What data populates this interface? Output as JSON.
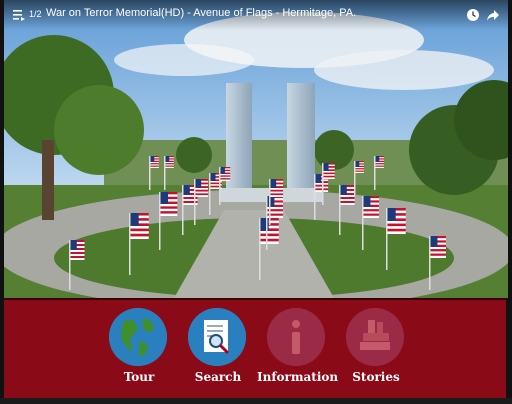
{
  "video": {
    "playlist_position": "1/2",
    "title": "War on Terror Memorial(HD) - Avenue of Flags - Hermitage, PA."
  },
  "menu": {
    "items": [
      {
        "label": "Tour",
        "icon": "globe-icon",
        "color": "#2a7fbf",
        "active": true
      },
      {
        "label": "Search",
        "icon": "search-document-icon",
        "color": "#2a7fbf",
        "active": true
      },
      {
        "label": "Information",
        "icon": "info-icon",
        "color": "#9b2a46",
        "active": false
      },
      {
        "label": "Stories",
        "icon": "books-icon",
        "color": "#9b2a46",
        "active": false
      }
    ]
  },
  "colors": {
    "menu_background": "#8b0a18",
    "sky": "#9fc3e6",
    "grass": "#4f7b2e"
  }
}
